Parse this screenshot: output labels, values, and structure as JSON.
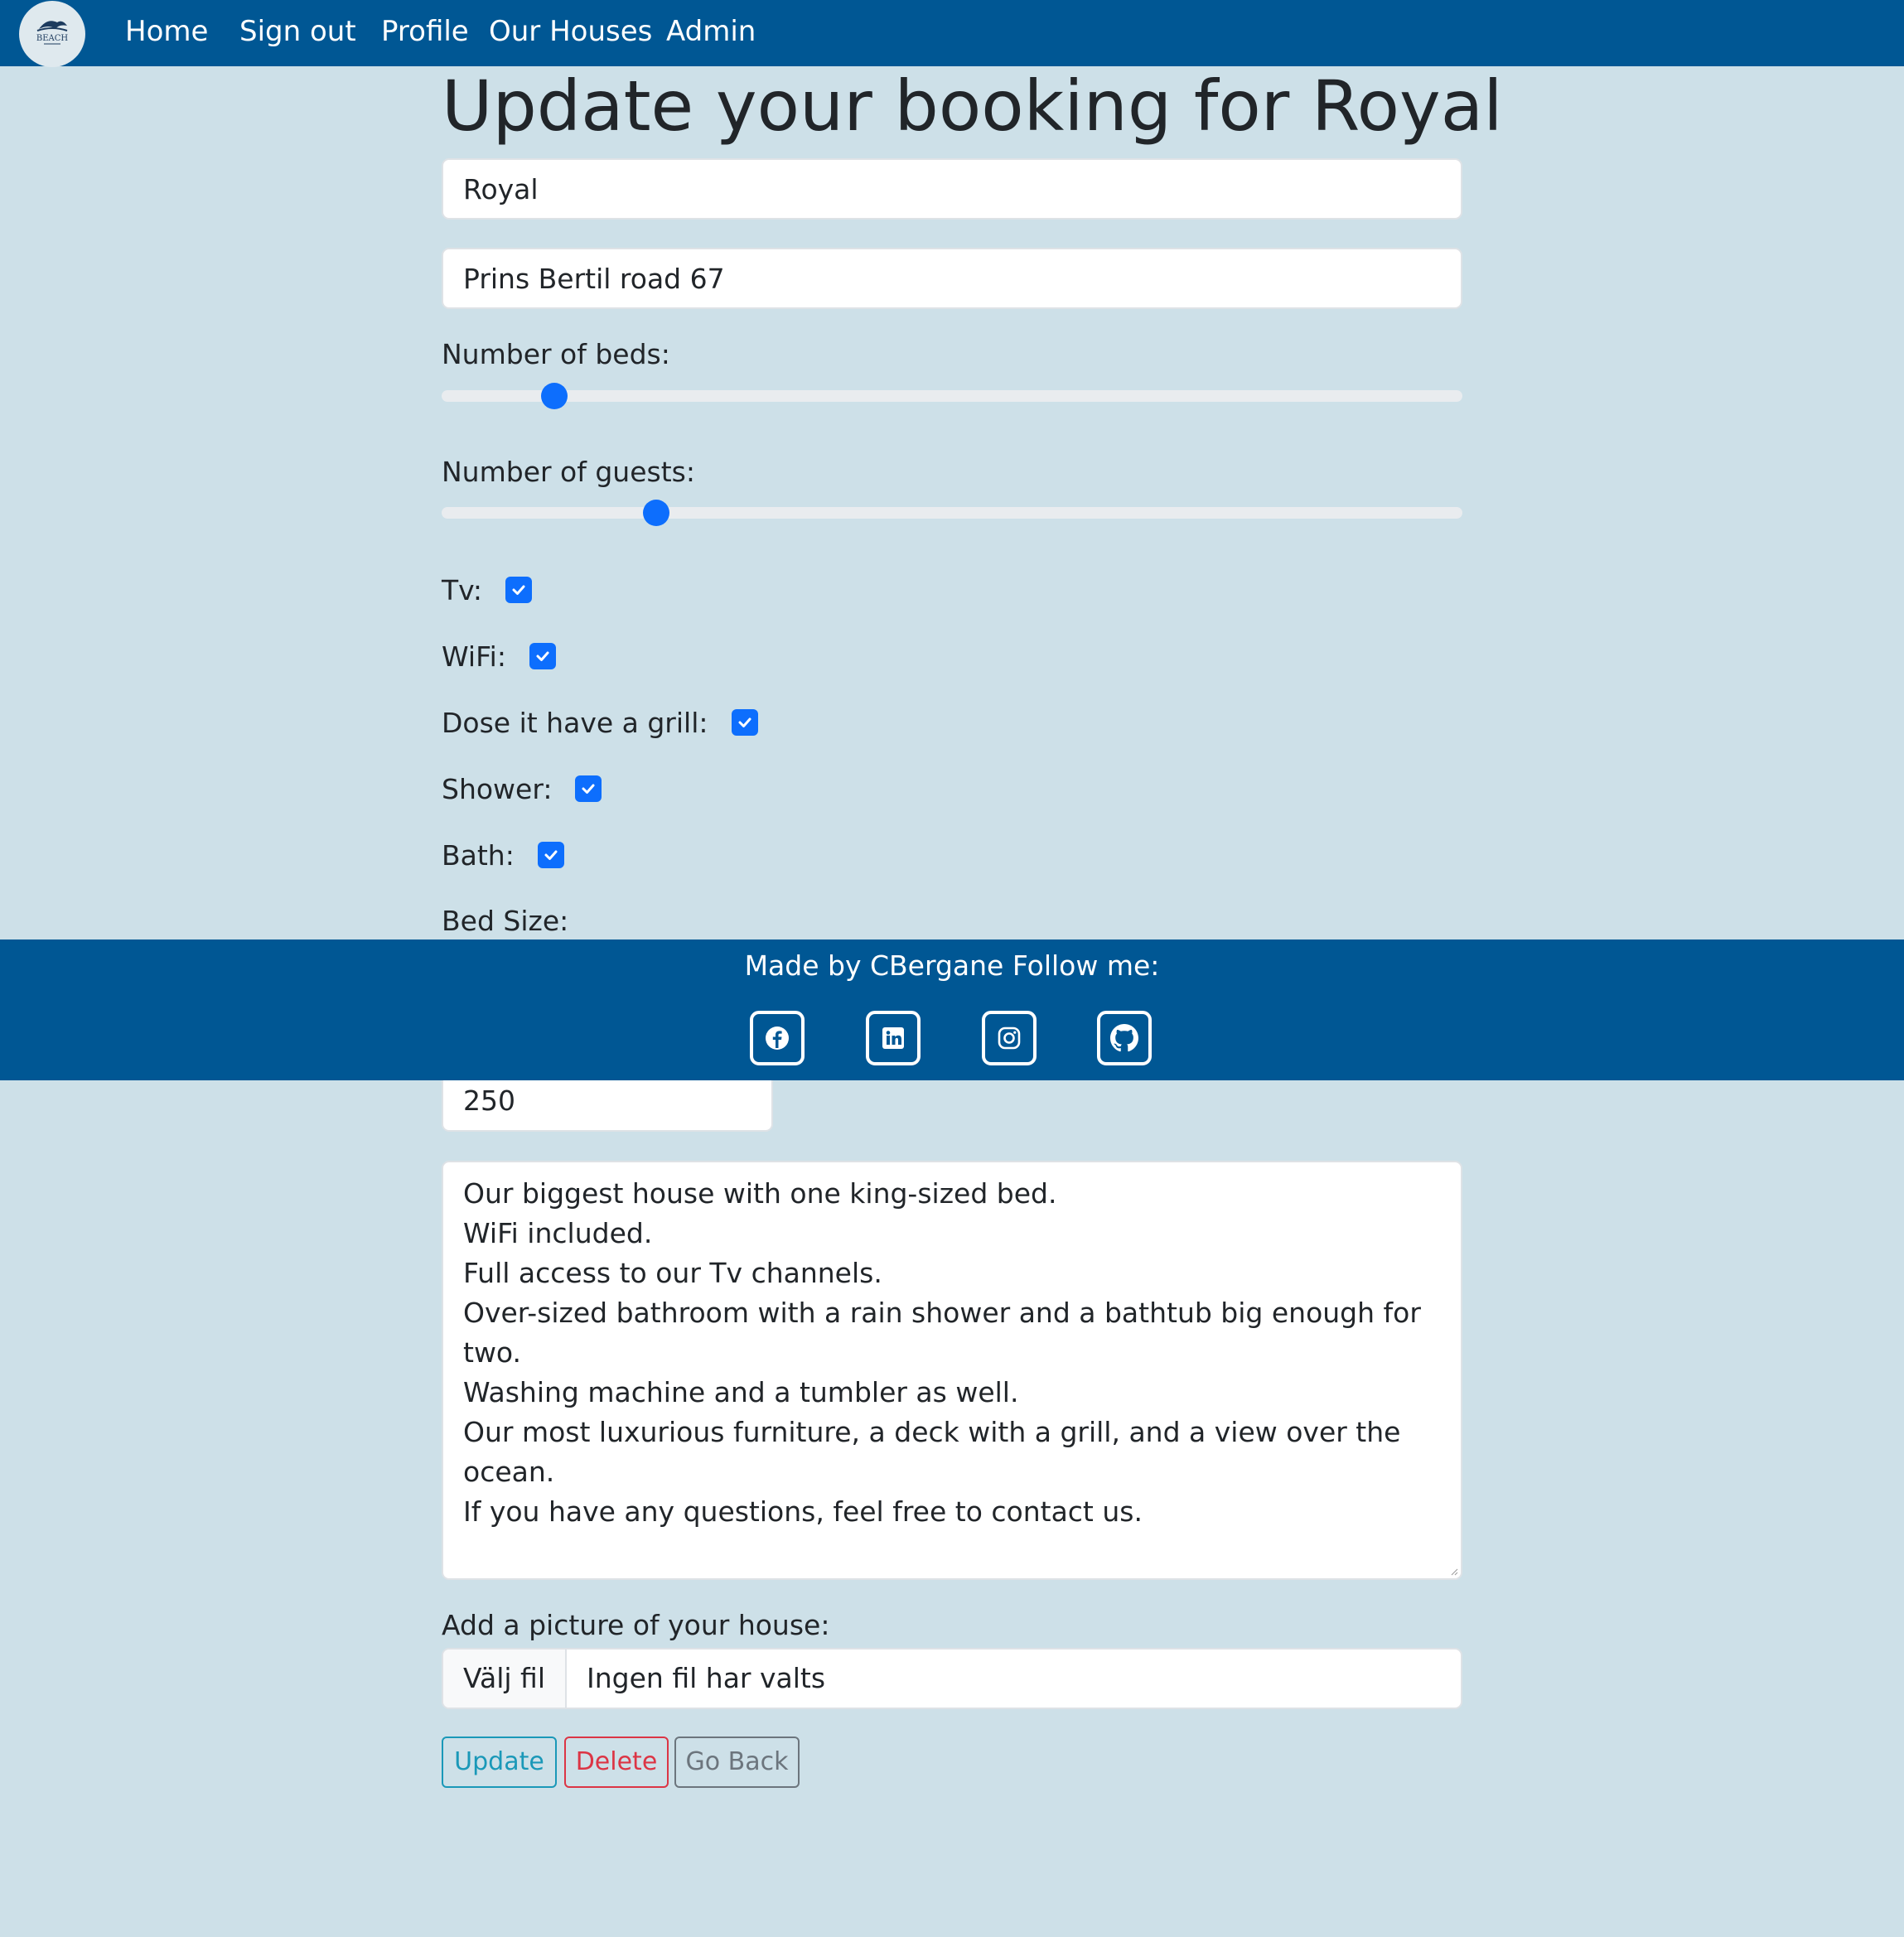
{
  "nav": {
    "logo_text": "BEACH",
    "links": [
      "Home",
      "Sign out",
      "Profile",
      "Our Houses",
      "Admin"
    ]
  },
  "form": {
    "title": "Update your booking for Royal",
    "name_value": "Royal",
    "address_value": "Prins Bertil road 67",
    "beds_label": "Number of beds:",
    "guests_label": "Number of guests:",
    "beds_fraction": 0.11,
    "guests_fraction": 0.21,
    "checkboxes": [
      {
        "label": "Tv:",
        "checked": true
      },
      {
        "label": "WiFi:",
        "checked": true
      },
      {
        "label": "Dose it have a grill:",
        "checked": true
      },
      {
        "label": "Shower:",
        "checked": true
      },
      {
        "label": "Bath:",
        "checked": true
      }
    ],
    "bed_size_label": "Bed Size:",
    "price_value": "250",
    "description_lines": [
      "Our biggest house with one king-sized bed.",
      "WiFi included.",
      "Full access to our Tv channels.",
      "Over-sized bathroom with a rain shower and a bathtub big enough for",
      "two.",
      "Washing machine and a tumbler as well.",
      "Our most luxurious furniture, a deck with a grill, and a view over the",
      "ocean.",
      "If you have any questions, feel free to contact us."
    ],
    "picture_label": "Add a picture of your house:",
    "file_button": "Välj fil",
    "file_status": "Ingen fil har valts",
    "buttons": {
      "update": "Update",
      "delete": "Delete",
      "back": "Go Back"
    }
  },
  "footer": {
    "text": "Made by CBergane Follow me:",
    "socials": [
      "facebook-icon",
      "linkedin-icon",
      "instagram-icon",
      "github-icon"
    ]
  },
  "colors": {
    "navbar": "#005794",
    "background": "#cde0e8",
    "accent": "#0d6efd"
  }
}
